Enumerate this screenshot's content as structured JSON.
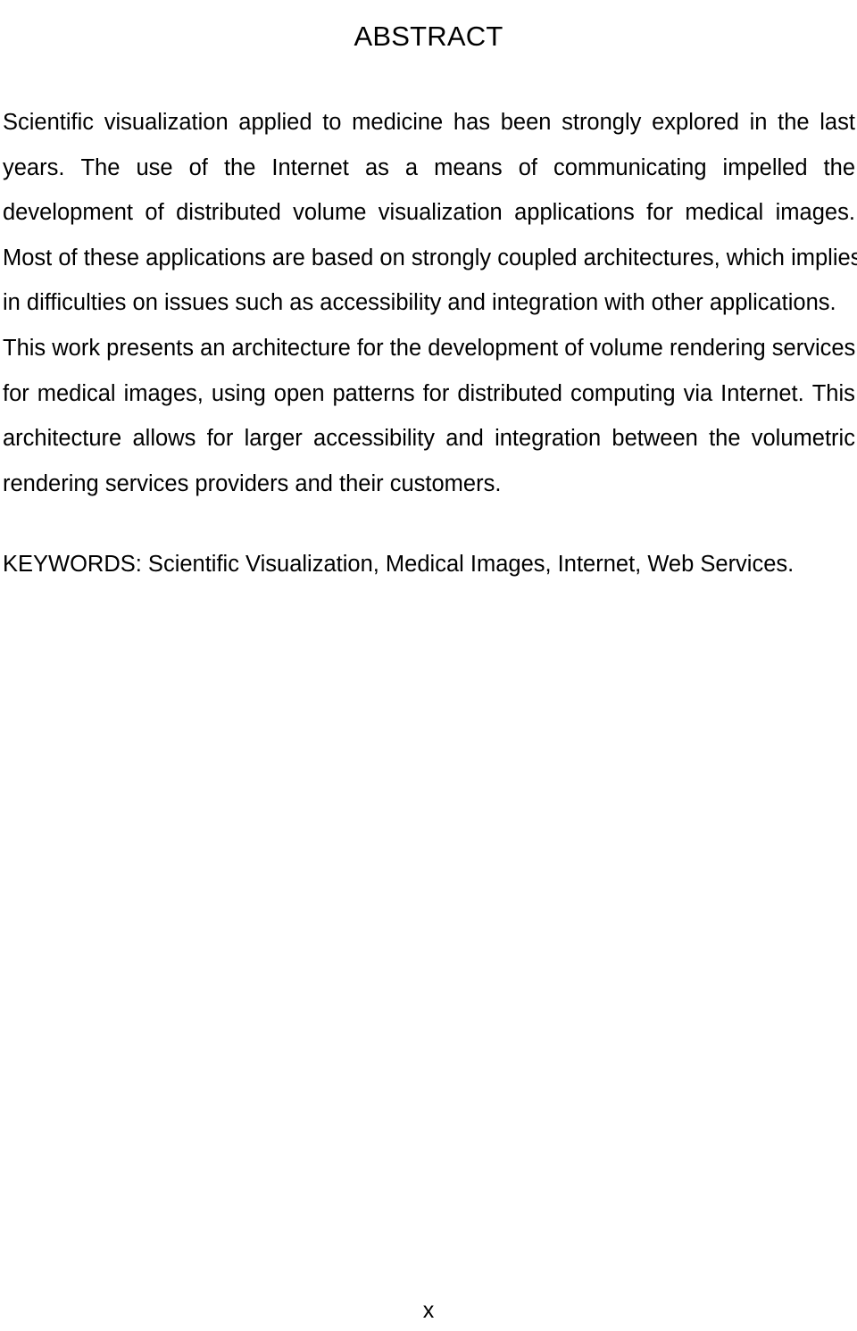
{
  "document": {
    "heading": "ABSTRACT",
    "page_number": "x",
    "text_color": "#000000",
    "background_color": "#ffffff"
  },
  "abstract": {
    "full_text": "Scientific visualization applied to medicine has been strongly explored in the last years. The use of the Internet as a means of communicating impelled the development of distributed volume visualization applications for medical images. Most of these applications are based on strongly coupled architectures, which implies in difficulties on issues such as accessibility and integration with other applications. This work presents an architecture for the development of volume rendering services for medical images, using open patterns for distributed computing via Internet. This architecture allows for larger accessibility and integration between the volumetric rendering services providers and their customers.",
    "lines": [
      {
        "id": "line-1",
        "justified": true,
        "text": "Scientific visualization applied to medicine has been strongly explored in the last",
        "words": [
          "Scientific",
          "visualization",
          "applied",
          "to",
          "medicine",
          "has",
          "been",
          "strongly",
          "explored",
          "in",
          "the",
          "last"
        ]
      },
      {
        "id": "line-2",
        "justified": true,
        "text": "years. The use of the Internet as a means of communicating impelled the",
        "words": [
          "years.",
          "The",
          "use",
          "of",
          "the",
          "Internet",
          "as",
          "a",
          "means",
          "of",
          "communicating",
          "impelled",
          "the"
        ]
      },
      {
        "id": "line-3",
        "justified": true,
        "text": "development of distributed volume visualization applications for medical images.",
        "words": [
          "development",
          "of",
          "distributed",
          "volume",
          "visualization",
          "applications",
          "for",
          "medical",
          "images."
        ]
      },
      {
        "id": "line-4",
        "justified": false,
        "text": "Most of these applications are based on strongly coupled architectures, which implies",
        "words": [
          "Most",
          "of",
          "these",
          "applications",
          "are",
          "based",
          "on",
          "strongly",
          "coupled",
          "architectures,",
          "which",
          "implies"
        ]
      },
      {
        "id": "line-5",
        "justified": false,
        "text": "in difficulties on issues such as accessibility and integration with other applications.",
        "words": [
          "in",
          "difficulties",
          "on",
          "issues",
          "such",
          "as",
          "accessibility",
          "and",
          "integration",
          "with",
          "other",
          "applications."
        ]
      },
      {
        "id": "line-6",
        "justified": false,
        "text": "This work presents an architecture for the development of volume rendering services",
        "words": [
          "This",
          "work",
          "presents",
          "an",
          "architecture",
          "for",
          "the",
          "development",
          "of",
          "volume",
          "rendering",
          "services"
        ]
      },
      {
        "id": "line-7",
        "justified": true,
        "text": "for medical images, using open patterns for distributed computing via Internet. This",
        "words": [
          "for",
          "medical",
          "images,",
          "using",
          "open",
          "patterns",
          "for",
          "distributed",
          "computing",
          "via",
          "Internet.",
          "This"
        ]
      },
      {
        "id": "line-8",
        "justified": true,
        "text": "architecture allows for larger accessibility and integration between the volumetric",
        "words": [
          "architecture",
          "allows",
          "for",
          "larger",
          "accessibility",
          "and",
          "integration",
          "between",
          "the",
          "volumetric"
        ]
      },
      {
        "id": "line-9",
        "justified": false,
        "text": "rendering services providers and their customers.",
        "words": [
          "rendering",
          "services",
          "providers",
          "and",
          "their",
          "customers."
        ]
      }
    ]
  },
  "keywords": {
    "label": "KEYWORDS:",
    "line": "KEYWORDS: Scientific Visualization, Medical Images, Internet, Web Services.",
    "terms": [
      "Scientific Visualization",
      "Medical Images",
      "Internet",
      "Web Services"
    ]
  }
}
